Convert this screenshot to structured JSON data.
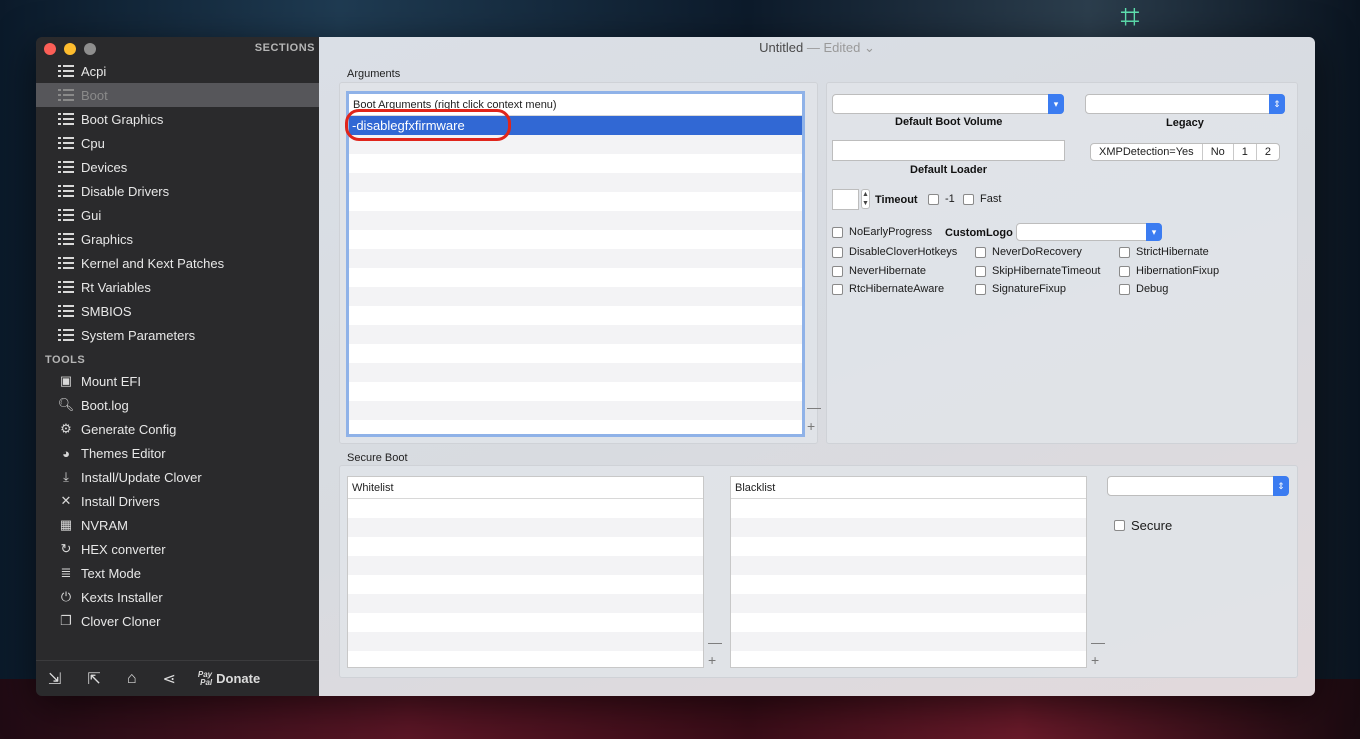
{
  "window": {
    "title": "Untitled",
    "edited": "— Edited ⌄"
  },
  "sidebar": {
    "sections_header": "SECTIONS",
    "sections": [
      {
        "label": "Acpi"
      },
      {
        "label": "Boot"
      },
      {
        "label": "Boot Graphics"
      },
      {
        "label": "Cpu"
      },
      {
        "label": "Devices"
      },
      {
        "label": "Disable Drivers"
      },
      {
        "label": "Gui"
      },
      {
        "label": "Graphics"
      },
      {
        "label": "Kernel and Kext Patches"
      },
      {
        "label": "Rt Variables"
      },
      {
        "label": "SMBIOS"
      },
      {
        "label": "System Parameters"
      }
    ],
    "selected_section": "Boot",
    "tools_header": "TOOLS",
    "tools": [
      {
        "label": "Mount EFI",
        "icon": "disk-icon"
      },
      {
        "label": "Boot.log",
        "icon": "log-icon"
      },
      {
        "label": "Generate Config",
        "icon": "gears-icon"
      },
      {
        "label": "Themes Editor",
        "icon": "palette-icon"
      },
      {
        "label": "Install/Update Clover",
        "icon": "download-icon"
      },
      {
        "label": "Install Drivers",
        "icon": "tools-icon"
      },
      {
        "label": "NVRAM",
        "icon": "chip-icon"
      },
      {
        "label": "HEX converter",
        "icon": "refresh-icon"
      },
      {
        "label": "Text Mode",
        "icon": "text-icon"
      },
      {
        "label": "Kexts Installer",
        "icon": "plug-icon"
      },
      {
        "label": "Clover Cloner",
        "icon": "copy-icon"
      }
    ],
    "footer": {
      "paypal_top": "Pay",
      "paypal_bottom": "Pal",
      "donate": "Donate"
    }
  },
  "arguments": {
    "group_label": "Arguments",
    "table_header": "Boot Arguments (right click context menu)",
    "rows": [
      "-disablegfxfirmware"
    ],
    "minus": "—",
    "plus": "+"
  },
  "boot_options": {
    "default_boot_volume_label": "Default Boot Volume",
    "legacy_label": "Legacy",
    "default_loader_label": "Default Loader",
    "xmp_segments": [
      "XMPDetection=Yes",
      "No",
      "1",
      "2"
    ],
    "timeout_label": "Timeout",
    "minus_one_label": "-1",
    "fast_label": "Fast",
    "no_early_progress": "NoEarlyProgress",
    "custom_logo_label": "CustomLogo",
    "checkboxes": [
      "DisableCloverHotkeys",
      "NeverDoRecovery",
      "StrictHibernate",
      "NeverHibernate",
      "SkipHibernateTimeout",
      "HibernationFixup",
      "RtcHibernateAware",
      "SignatureFixup",
      "Debug"
    ]
  },
  "secure_boot": {
    "group_label": "Secure Boot",
    "whitelist_header": "Whitelist",
    "blacklist_header": "Blacklist",
    "secure_label": "Secure",
    "minus": "—",
    "plus": "+"
  },
  "colors": {
    "selection": "#3168d4",
    "highlight_circle": "#e0251b",
    "popup_arrow": "#3b7cf1"
  }
}
